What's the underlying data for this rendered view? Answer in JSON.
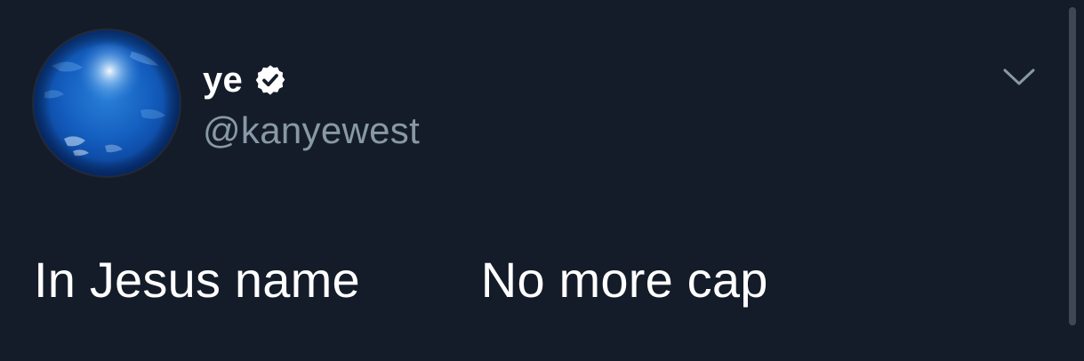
{
  "tweet": {
    "display_name": "ye",
    "handle": "@kanyewest",
    "verified": true,
    "text_part1": "In Jesus name",
    "text_part2": "No more cap"
  },
  "icons": {
    "avatar": "blue-earth-avatar",
    "verified": "verified-badge-icon",
    "menu": "chevron-down-icon"
  },
  "colors": {
    "background": "#151c29",
    "text_primary": "#ffffff",
    "text_secondary": "#8899a6",
    "chevron": "#8899a6",
    "scrollbar": "#3f4755"
  }
}
